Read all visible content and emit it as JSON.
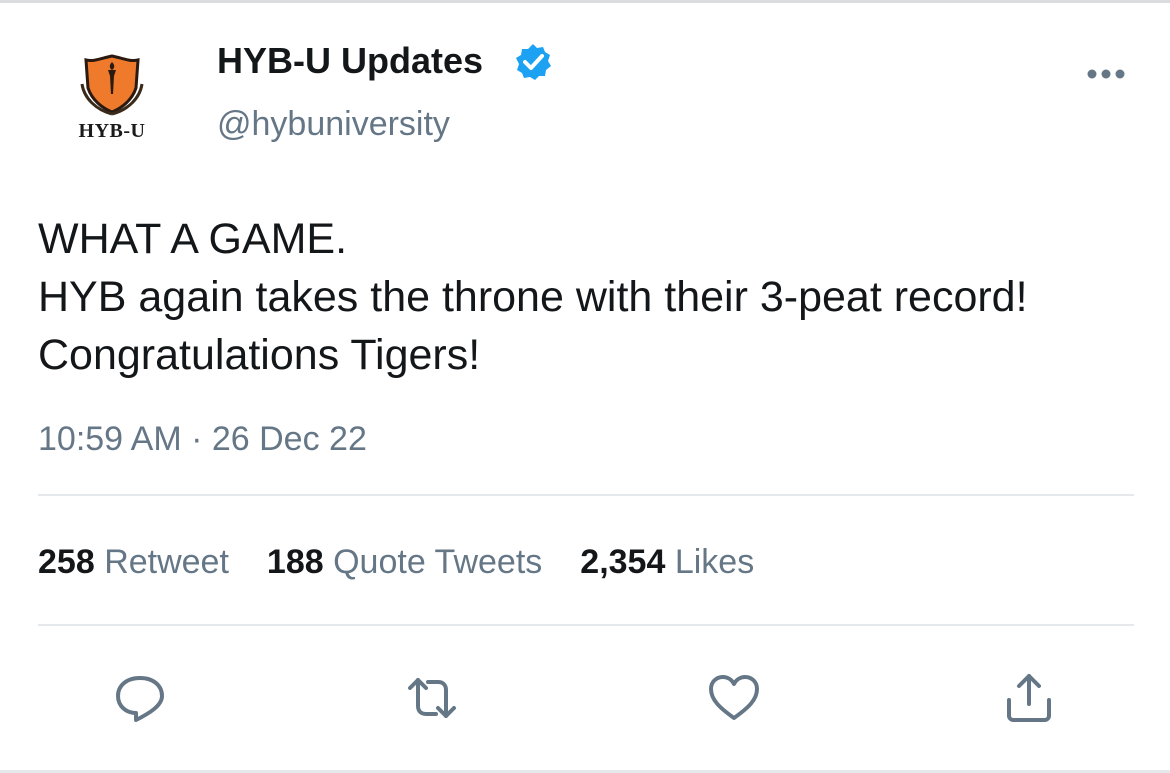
{
  "tweet": {
    "author": {
      "display_name": "HYB-U Updates",
      "handle": "@hybuniversity",
      "avatar_caption": "HYB-U",
      "avatar_icon": "shield-torch-logo",
      "verified": true,
      "verified_icon": "verified-badge-icon"
    },
    "text": "WHAT A GAME.\nHYB again takes the throne with their 3-peat record! Congratulations Tigers!",
    "timestamp": "10:59 AM · 26 Dec 22",
    "stats": {
      "retweets": {
        "count": "258",
        "label": "Retweet"
      },
      "quotes": {
        "count": "188",
        "label": "Quote Tweets"
      },
      "likes": {
        "count": "2,354",
        "label": "Likes"
      }
    },
    "actions": [
      "reply-icon",
      "retweet-icon",
      "like-icon",
      "share-icon"
    ],
    "more_icon": "more-options-icon"
  },
  "colors": {
    "primary_text": "#14171a",
    "secondary_text": "#657786",
    "verified_blue": "#1da1f2",
    "logo_orange": "#f07a2c",
    "divider": "#e6e9ec"
  }
}
